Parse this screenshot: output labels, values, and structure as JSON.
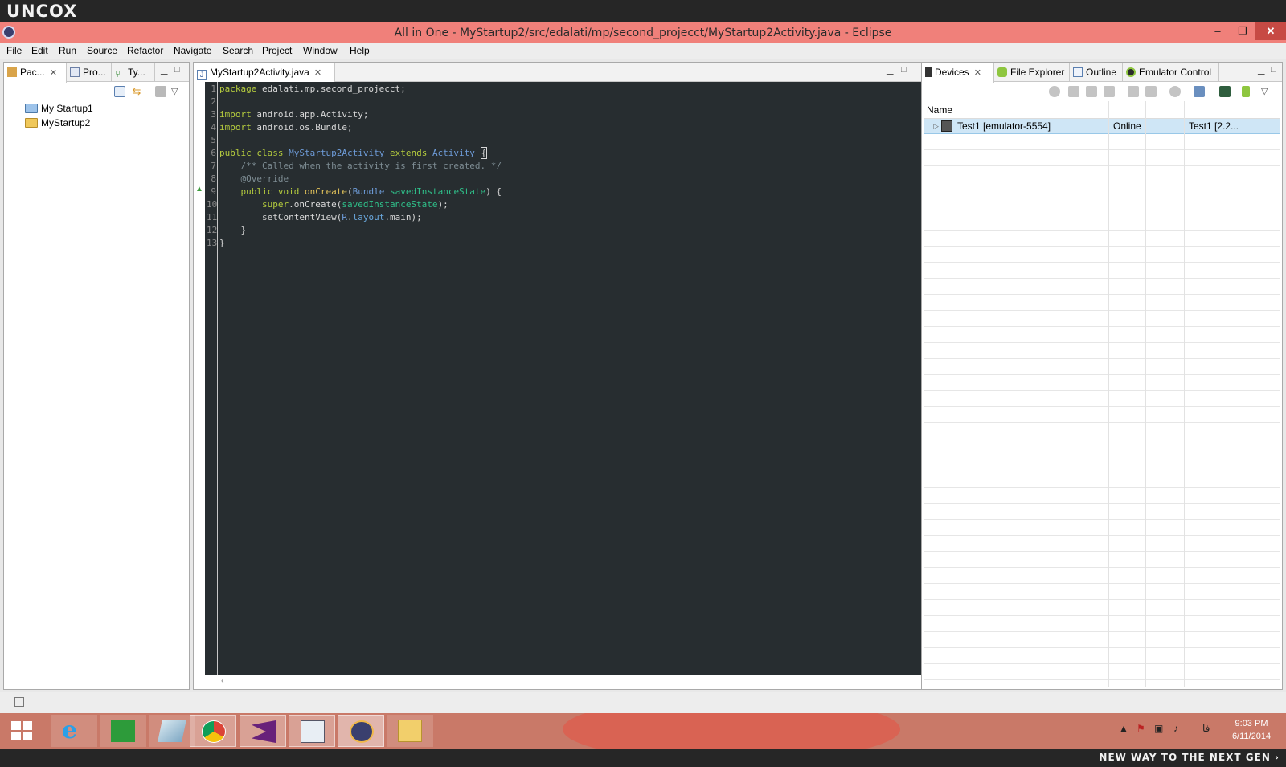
{
  "branding": {
    "logo": "UNCOX",
    "slogan": "NEW WAY TO THE NEXT GEN ›"
  },
  "window": {
    "title": "All in One - MyStartup2/src/edalati/mp/second_projecct/MyStartup2Activity.java - Eclipse",
    "minimize": "–",
    "maximize": "❐",
    "close": "✕"
  },
  "menu": [
    "File",
    "Edit",
    "Run",
    "Source",
    "Refactor",
    "Navigate",
    "Search",
    "Project",
    "Window",
    "Help"
  ],
  "left_panel": {
    "tabs": [
      {
        "label": "Pac...",
        "active": true
      },
      {
        "label": "Pro...",
        "active": false
      },
      {
        "label": "Ty...",
        "active": false
      }
    ],
    "tree": [
      "My Startup1",
      "MyStartup2"
    ]
  },
  "editor": {
    "tab_label": "MyStartup2Activity.java",
    "line_numbers": [
      "1",
      "2",
      "3",
      "4",
      "5",
      "6",
      "7",
      "8",
      "9",
      "10",
      "11",
      "12",
      "13"
    ]
  },
  "right_panel": {
    "tabs": [
      {
        "label": "Devices",
        "active": true
      },
      {
        "label": "File Explorer",
        "active": false
      },
      {
        "label": "Outline",
        "active": false
      },
      {
        "label": "Emulator Control",
        "active": false
      }
    ],
    "column_name": "Name",
    "device": {
      "name": "Test1 [emulator-5554]",
      "state": "Online",
      "target": "Test1 [2.2..."
    }
  },
  "taskbar": {
    "time": "9:03 PM",
    "date": "6/11/2014",
    "lang": "فا"
  }
}
